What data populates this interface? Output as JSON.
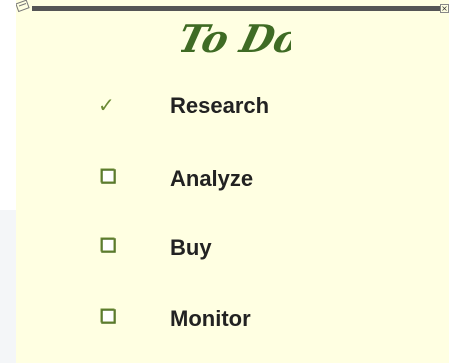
{
  "window": {
    "close_glyph": "×"
  },
  "title": "To Do",
  "colors": {
    "accent": "#5a7a2a",
    "note_bg": "#ffffe2",
    "titlebar": "#555555"
  },
  "items": [
    {
      "label": "Research",
      "state": "checked",
      "icon": "checkmark-icon"
    },
    {
      "label": "Analyze",
      "state": "unchecked",
      "icon": "checkbox-icon"
    },
    {
      "label": "Buy",
      "state": "unchecked",
      "icon": "checkbox-icon"
    },
    {
      "label": "Monitor",
      "state": "unchecked",
      "icon": "checkbox-icon"
    }
  ]
}
